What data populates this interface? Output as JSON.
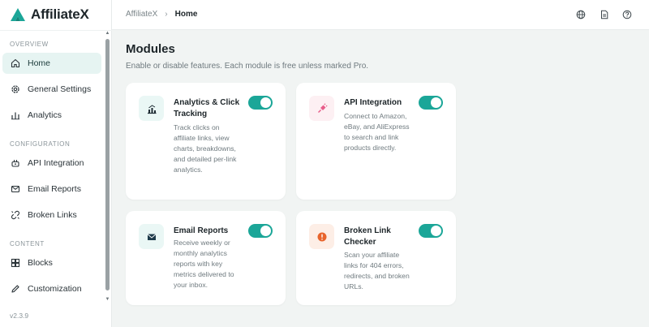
{
  "app": {
    "name": "AffiliateX",
    "version": "v2.3.9"
  },
  "colors": {
    "accent": "#1ba698",
    "active_bg": "#e6f4f2"
  },
  "sidebar": {
    "sections": [
      {
        "label": "OVERVIEW"
      },
      {
        "label": "CONFIGURATION"
      },
      {
        "label": "CONTENT"
      }
    ],
    "items": [
      {
        "label": "Home",
        "icon": "home-icon",
        "active": true
      },
      {
        "label": "General Settings",
        "icon": "gear-icon"
      },
      {
        "label": "Analytics",
        "icon": "bar-chart-icon"
      },
      {
        "label": "API Integration",
        "icon": "plug-icon"
      },
      {
        "label": "Email Reports",
        "icon": "mail-icon"
      },
      {
        "label": "Broken Links",
        "icon": "broken-link-icon"
      },
      {
        "label": "Blocks",
        "icon": "blocks-icon"
      },
      {
        "label": "Customization",
        "icon": "pencil-icon"
      }
    ]
  },
  "header": {
    "breadcrumb": [
      "AffiliateX",
      "Home"
    ],
    "icons": [
      "globe-icon",
      "document-icon",
      "help-icon"
    ]
  },
  "main": {
    "title": "Modules",
    "subtitle": "Enable or disable features. Each module is free unless marked Pro.",
    "modules": [
      {
        "title": "Analytics & Click Tracking",
        "description": "Track clicks on affiliate links, view charts, breakdowns, and detailed per-link analytics.",
        "icon": "analytics-chart-icon",
        "enabled": true
      },
      {
        "title": "API Integration",
        "description": "Connect to Amazon, eBay, and AliExpress to search and link products directly.",
        "icon": "api-plug-icon",
        "enabled": true
      },
      {
        "title": "Email Reports",
        "description": "Receive weekly or monthly analytics reports with key metrics delivered to your inbox.",
        "icon": "envelope-icon",
        "enabled": true
      },
      {
        "title": "Broken Link Checker",
        "description": "Scan your affiliate links for 404 errors, redirects, and broken URLs.",
        "icon": "alert-icon",
        "enabled": true
      }
    ]
  }
}
